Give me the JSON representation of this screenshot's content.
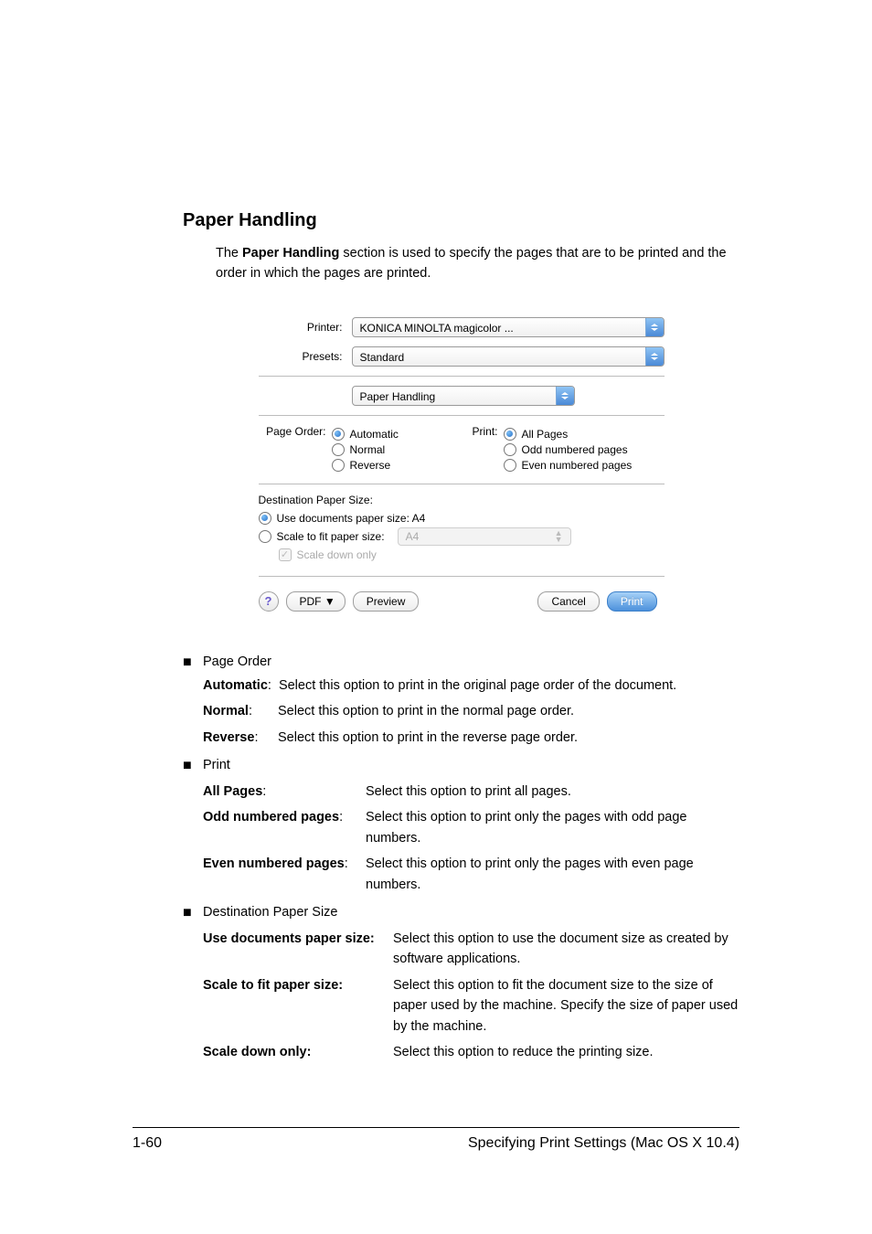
{
  "heading": "Paper Handling",
  "intro_prefix": "The ",
  "intro_bold": "Paper Handling",
  "intro_suffix": " section is used to specify the pages that are to be printed and the order in which the pages are printed.",
  "dialog": {
    "printer_label": "Printer:",
    "printer_value": "KONICA MINOLTA magicolor ...",
    "presets_label": "Presets:",
    "presets_value": "Standard",
    "section_value": "Paper Handling",
    "page_order_label": "Page Order:",
    "page_order_options": [
      "Automatic",
      "Normal",
      "Reverse"
    ],
    "print_label": "Print:",
    "print_options": [
      "All Pages",
      "Odd numbered pages",
      "Even numbered pages"
    ],
    "dest_title": "Destination Paper Size:",
    "dest_use_docs": "Use documents paper size:  A4",
    "dest_scale_fit": "Scale to fit paper size:",
    "dest_scale_value": "A4",
    "dest_scale_down": "Scale down only",
    "help": "?",
    "pdf_btn": "PDF ▼",
    "preview_btn": "Preview",
    "cancel_btn": "Cancel",
    "print_btn": "Print"
  },
  "sections": {
    "page_order": {
      "title": "Page Order",
      "items": [
        {
          "term": "Automatic",
          "body": "Select this option to print in the original page order of the document."
        },
        {
          "term": "Normal",
          "body": "Select this option to print in the normal page order."
        },
        {
          "term": "Reverse",
          "body": "Select this option to print in the reverse page order."
        }
      ]
    },
    "print": {
      "title": "Print",
      "items": [
        {
          "term": "All Pages",
          "body": "Select this option to print all pages."
        },
        {
          "term": "Odd numbered pages",
          "body": "Select this option to print only the pages with odd page numbers."
        },
        {
          "term": "Even numbered pages",
          "body": "Select this option to print only the pages with even page numbers."
        }
      ]
    },
    "dest": {
      "title": "Destination Paper Size",
      "items": [
        {
          "term": "Use documents paper size",
          "body": "Select this option to use the document size as created by software applications."
        },
        {
          "term": "Scale to fit paper size",
          "body": "Select this option to fit the document size to the size of paper used by the machine. Specify the size of paper used by the machine."
        },
        {
          "term": "Scale down only",
          "body": "Select this option to reduce the printing size."
        }
      ]
    }
  },
  "footer_left": "1-60",
  "footer_right": "Specifying Print Settings (Mac OS X 10.4)"
}
